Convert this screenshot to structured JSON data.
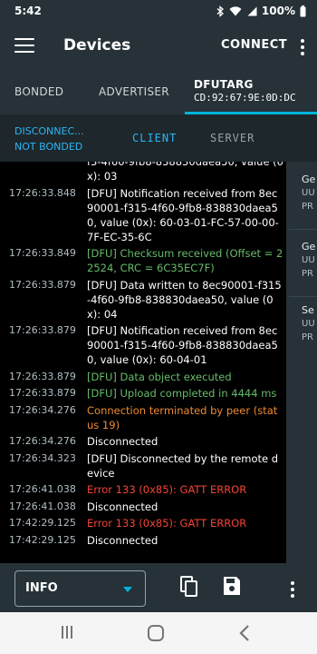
{
  "status_bar": {
    "time": "5:42",
    "battery": "100%"
  },
  "app_bar": {
    "title": "Devices",
    "connect_label": "CONNECT"
  },
  "tabs": {
    "bonded": "BONDED",
    "advertiser": "ADVERTISER",
    "device_name": "DFUTARG",
    "device_address": "CD:92:67:9E:0D:DC"
  },
  "sub_bar": {
    "state_line1": "DISCONNEC...",
    "state_line2": "NOT BONDED",
    "client_label": "CLIENT",
    "server_label": "SERVER"
  },
  "log": [
    {
      "time": "",
      "color": "white",
      "text": "f3-4f60-9fb8-838830daea50, value (0x): 03"
    },
    {
      "time": "17:26:33.848",
      "color": "white",
      "text": "[DFU] Notification received from 8ec90001-f315-4f60-9fb8-838830daea50, value (0x): 60-03-01-FC-57-00-00-7F-EC-35-6C"
    },
    {
      "time": "17:26:33.849",
      "color": "green",
      "text": "[DFU] Checksum received (Offset = 22524, CRC = 6C35EC7F)"
    },
    {
      "time": "17:26:33.879",
      "color": "white",
      "text": "[DFU] Data written to 8ec90001-f315-4f60-9fb8-838830daea50, value (0x): 04"
    },
    {
      "time": "17:26:33.879",
      "color": "white",
      "text": "[DFU] Notification received from 8ec90001-f315-4f60-9fb8-838830daea50, value (0x): 60-04-01"
    },
    {
      "time": "17:26:33.879",
      "color": "green",
      "text": "[DFU] Data object executed"
    },
    {
      "time": "17:26:33.879",
      "color": "green",
      "text": "[DFU] Upload completed in 4444 ms"
    },
    {
      "time": "17:26:34.276",
      "color": "orange",
      "text": "Connection terminated by peer (status 19)"
    },
    {
      "time": "17:26:34.276",
      "color": "white",
      "text": "Disconnected"
    },
    {
      "time": "17:26:34.323",
      "color": "white",
      "text": "[DFU] Disconnected by the remote device"
    },
    {
      "time": "17:26:41.038",
      "color": "red",
      "text": "Error 133 (0x85): GATT ERROR"
    },
    {
      "time": "17:26:41.038",
      "color": "white",
      "text": "Disconnected"
    },
    {
      "time": "17:42:29.125",
      "color": "red",
      "text": "Error 133 (0x85): GATT ERROR"
    },
    {
      "time": "17:42:29.125",
      "color": "white",
      "text": "Disconnected"
    }
  ],
  "side_panel": [
    {
      "h": "Ge",
      "l1": "UU",
      "l2": "PR"
    },
    {
      "h": "Ge",
      "l1": "UU",
      "l2": "PR"
    },
    {
      "h": "Se",
      "l1": "UU",
      "l2": "PR"
    }
  ],
  "bottom_bar": {
    "log_level": "INFO"
  },
  "colors": {
    "accent": "#00b3dc",
    "app_bar": "#263238",
    "log_background": "#000000",
    "log_green": "#66bb6a",
    "log_orange": "#ef8a30",
    "log_red": "#f44336"
  },
  "icons": {
    "menu": "hamburger-menu-icon",
    "overflow": "more-vert-icon",
    "copy": "copy-icon",
    "save": "save-icon",
    "bluetooth": "bluetooth-icon",
    "wifi": "wifi-icon",
    "signal": "signal-icon",
    "battery": "battery-icon"
  }
}
